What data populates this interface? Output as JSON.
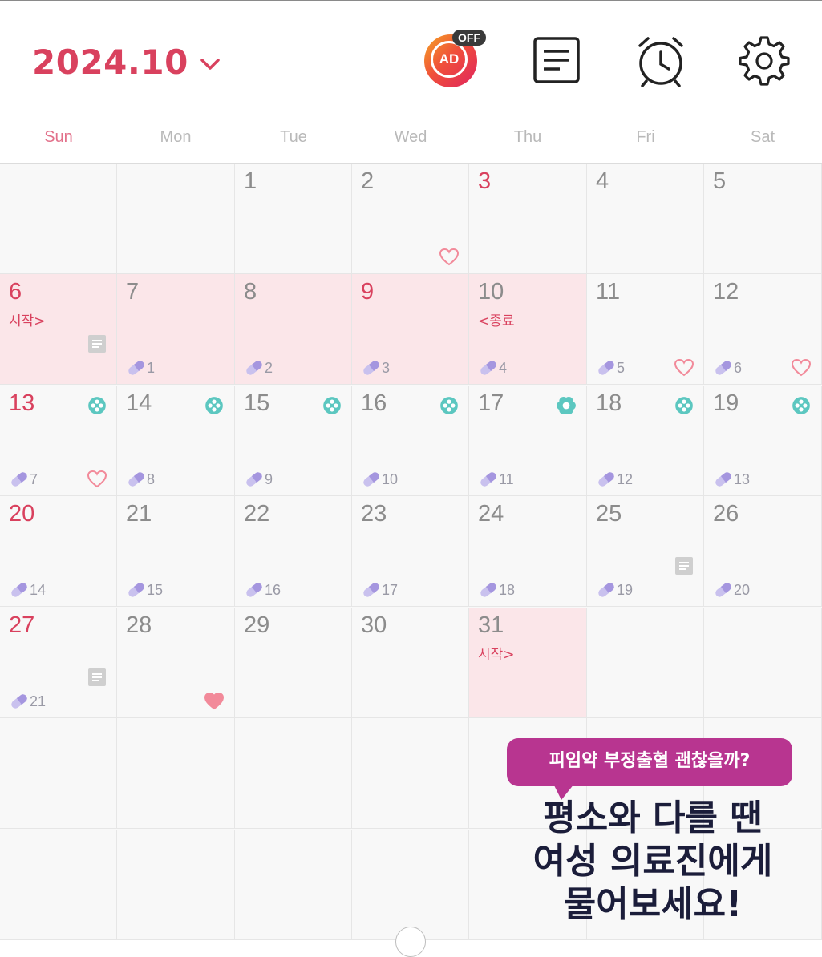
{
  "header": {
    "month": "2024.10",
    "ad_label": "AD",
    "ad_badge": "OFF",
    "icons": [
      "chevron-down-icon",
      "ad-toggle-icon",
      "memo-icon",
      "alarm-clock-icon",
      "settings-gear-icon"
    ]
  },
  "weekdays": [
    "Sun",
    "Mon",
    "Tue",
    "Wed",
    "Thu",
    "Fri",
    "Sat"
  ],
  "colors": {
    "accent": "#d9415e",
    "period_bg": "#fbe6e9",
    "pill": "#b9aee6",
    "teal": "#5cc7c0",
    "heart": "#f28a9a"
  },
  "calendar": {
    "days": [
      {
        "day": "1",
        "row": 0,
        "col": 2
      },
      {
        "day": "2",
        "row": 0,
        "col": 3,
        "heart": "outline"
      },
      {
        "day": "3",
        "row": 0,
        "col": 4,
        "red": true
      },
      {
        "day": "4",
        "row": 0,
        "col": 5
      },
      {
        "day": "5",
        "row": 0,
        "col": 6
      },
      {
        "day": "6",
        "row": 1,
        "col": 0,
        "red": true,
        "period": true,
        "mark": "시작>",
        "note": true
      },
      {
        "day": "7",
        "row": 1,
        "col": 1,
        "period": true,
        "pill": "1"
      },
      {
        "day": "8",
        "row": 1,
        "col": 2,
        "period": true,
        "pill": "2"
      },
      {
        "day": "9",
        "row": 1,
        "col": 3,
        "red": true,
        "period": true,
        "pill": "3"
      },
      {
        "day": "10",
        "row": 1,
        "col": 4,
        "period": true,
        "mark": "<종료",
        "pill": "4"
      },
      {
        "day": "11",
        "row": 1,
        "col": 5,
        "pill": "5",
        "heart": "outline"
      },
      {
        "day": "12",
        "row": 1,
        "col": 6,
        "pill": "6",
        "heart": "outline"
      },
      {
        "day": "13",
        "row": 2,
        "col": 0,
        "red": true,
        "pill": "7",
        "heart": "outline",
        "ovul": "dot"
      },
      {
        "day": "14",
        "row": 2,
        "col": 1,
        "pill": "8",
        "ovul": "dot"
      },
      {
        "day": "15",
        "row": 2,
        "col": 2,
        "pill": "9",
        "ovul": "dot"
      },
      {
        "day": "16",
        "row": 2,
        "col": 3,
        "pill": "10",
        "ovul": "dot"
      },
      {
        "day": "17",
        "row": 2,
        "col": 4,
        "pill": "11",
        "ovul": "flower"
      },
      {
        "day": "18",
        "row": 2,
        "col": 5,
        "pill": "12",
        "ovul": "dot"
      },
      {
        "day": "19",
        "row": 2,
        "col": 6,
        "pill": "13",
        "ovul": "dot"
      },
      {
        "day": "20",
        "row": 3,
        "col": 0,
        "red": true,
        "pill": "14"
      },
      {
        "day": "21",
        "row": 3,
        "col": 1,
        "pill": "15"
      },
      {
        "day": "22",
        "row": 3,
        "col": 2,
        "pill": "16"
      },
      {
        "day": "23",
        "row": 3,
        "col": 3,
        "pill": "17"
      },
      {
        "day": "24",
        "row": 3,
        "col": 4,
        "pill": "18"
      },
      {
        "day": "25",
        "row": 3,
        "col": 5,
        "pill": "19",
        "note": true
      },
      {
        "day": "26",
        "row": 3,
        "col": 6,
        "pill": "20"
      },
      {
        "day": "27",
        "row": 4,
        "col": 0,
        "red": true,
        "pill": "21",
        "note": true
      },
      {
        "day": "28",
        "row": 4,
        "col": 1,
        "heart": "filled"
      },
      {
        "day": "29",
        "row": 4,
        "col": 2
      },
      {
        "day": "30",
        "row": 4,
        "col": 3
      },
      {
        "day": "31",
        "row": 4,
        "col": 4,
        "period": true,
        "mark": "시작>"
      }
    ]
  },
  "banner": {
    "bubble": "피임약 부정출혈 괜찮을까?",
    "line1": "평소와 다를 땐",
    "line2": "여성 의료진에게",
    "line3": "물어보세요!"
  }
}
